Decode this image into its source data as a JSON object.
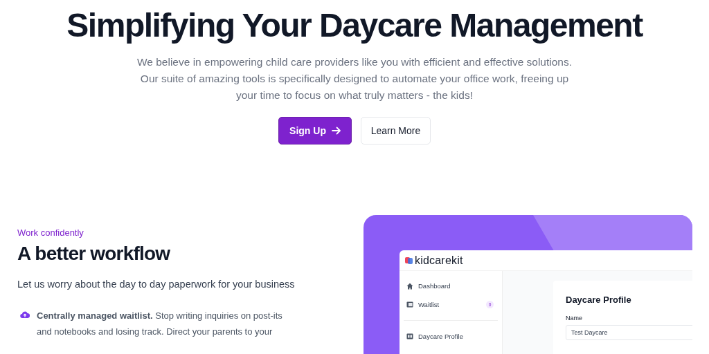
{
  "hero": {
    "title": "Simplifying Your Daycare Management",
    "lines": [
      "We believe in empowering child care providers like you with efficient and effective solutions.",
      "Our suite of amazing tools is specifically designed to automate your office work, freeing up",
      "your time to focus on what truly matters - the kids!"
    ],
    "primary_button": "Sign Up",
    "secondary_button": "Learn More"
  },
  "section": {
    "eyebrow": "Work confidently",
    "title": "A better workflow",
    "lead": "Let us worry about the day to day paperwork for your business",
    "features": [
      {
        "text": "**Centrally managed waitlist.** Stop writing inquiries on post-its and notebooks and losing track. Direct your parents to your"
      }
    ]
  },
  "app": {
    "logo": "kidcarekit",
    "nav": [
      {
        "label": "Dashboard",
        "kind": "home"
      },
      {
        "label": "Waitlist",
        "kind": "list",
        "badge": "0"
      },
      {
        "label": "Daycare Profile",
        "kind": "card"
      }
    ],
    "form": {
      "title": "Daycare Profile",
      "fields": [
        {
          "label": "Name",
          "value": "Test Daycare"
        }
      ]
    }
  }
}
